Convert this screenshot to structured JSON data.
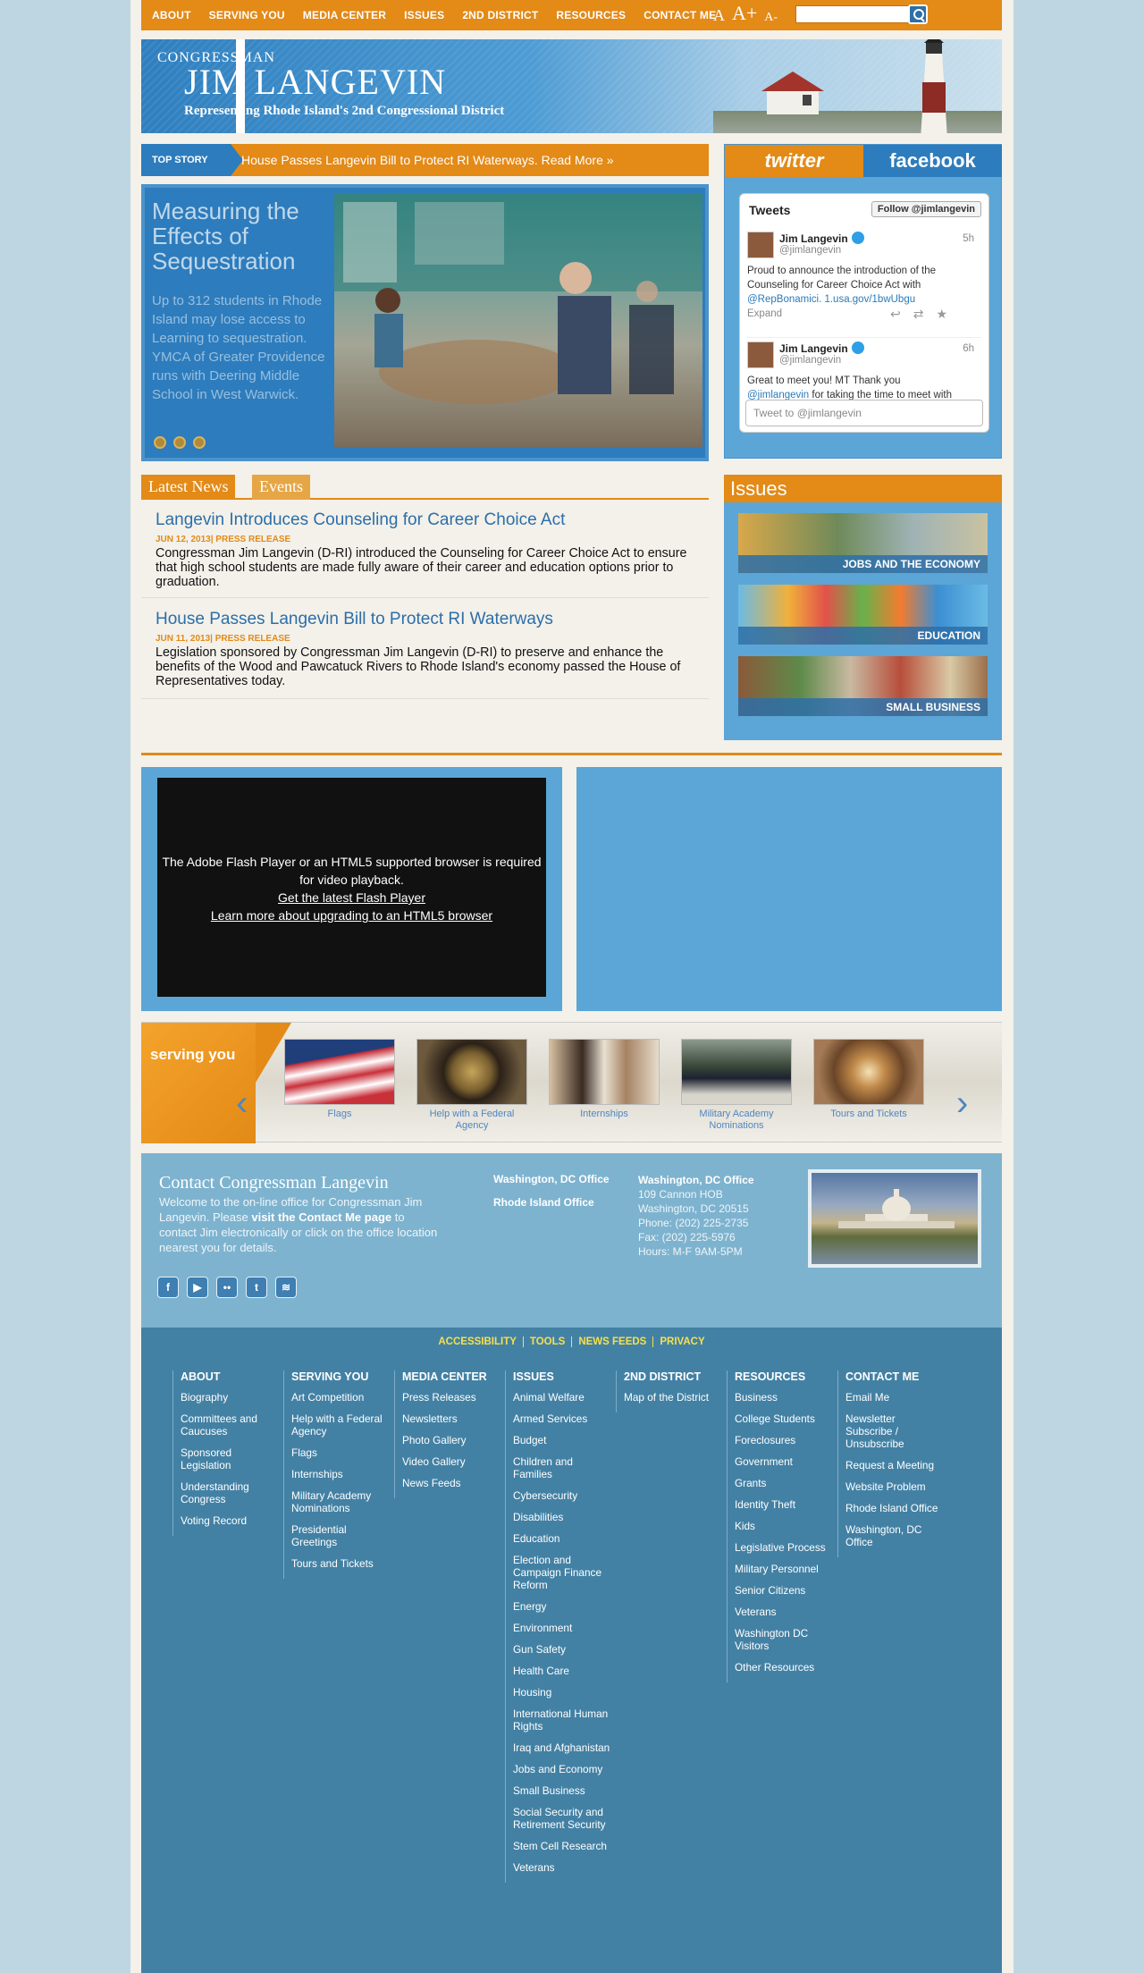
{
  "nav": {
    "items": [
      "ABOUT",
      "SERVING YOU",
      "MEDIA CENTER",
      "ISSUES",
      "2ND DISTRICT",
      "RESOURCES",
      "CONTACT ME"
    ],
    "font_sizes": [
      "A",
      "A+",
      "A-"
    ],
    "search_placeholder": ""
  },
  "header": {
    "congressman": "CONGRESSMAN",
    "name": "JIM LANGEVIN",
    "tagline": "Representing Rhode Island's 2nd Congressional District"
  },
  "top_story": {
    "label": "TOP STORY",
    "text": "House Passes Langevin Bill to Protect RI Waterways. Read More »"
  },
  "slideshow": {
    "title": "Measuring the Effects of Sequestration",
    "text": "Up to 312 students in Rhode Island may lose access to Learning to sequestration. YMCA of Greater Providence runs with Deering Middle School in West Warwick."
  },
  "twitter": {
    "tab_twitter": "twitter",
    "tab_facebook": "facebook",
    "heading": "Tweets",
    "follow": "Follow @jimlangevin",
    "tweets": [
      {
        "name": "Jim Langevin",
        "handle": "@jimlangevin",
        "time": "5h",
        "text": "Proud to announce the introduction of the Counseling for Career Choice Act with ",
        "link": "@RepBonamici. 1.usa.gov/1bwUbgu",
        "expand": "Expand"
      },
      {
        "name": "Jim Langevin",
        "handle": "@jimlangevin",
        "time": "6h",
        "text": "Great to meet you! MT Thank you ",
        "link": "@jimlangevin",
        "text2": " for taking the time to meet with"
      }
    ],
    "input_placeholder": "Tweet to @jimlangevin"
  },
  "news": {
    "tab_latest": "Latest News",
    "tab_events": "Events",
    "items": [
      {
        "title": "Langevin Introduces Counseling for Career Choice Act",
        "date": "JUN 12, 2013",
        "type": "PRESS RELEASE",
        "text": "Congressman Jim Langevin (D-RI) introduced the Counseling for Career Choice Act to ensure that high school students are made fully aware of their career and education options prior to graduation."
      },
      {
        "title": "House Passes Langevin Bill to Protect RI Waterways",
        "date": "JUN 11, 2013",
        "type": "PRESS RELEASE",
        "text": "Legislation sponsored by Congressman Jim Langevin (D-RI) to preserve and enhance the benefits of the Wood and Pawcatuck Rivers to Rhode Island's economy passed the House of Representatives today."
      }
    ]
  },
  "issues": {
    "heading": "Issues",
    "cards": [
      "JOBS AND THE ECONOMY",
      "EDUCATION",
      "SMALL BUSINESS"
    ]
  },
  "video": {
    "line1": "The Adobe Flash Player or an HTML5 supported browser is required for video playback.",
    "link1": "Get the latest Flash Player",
    "link2": "Learn more about upgrading to an HTML5 browser"
  },
  "serving": {
    "title": "serving you",
    "items": [
      "Flags",
      "Help with a Federal Agency",
      "Internships",
      "Military Academy Nominations",
      "Tours and Tickets"
    ]
  },
  "contact": {
    "heading": "Contact Congressman Langevin",
    "text_pre": "Welcome to the on-line office for Congressman Jim Langevin. Please ",
    "text_bold": "visit the Contact Me page",
    "text_post": " to contact Jim electronically or click on the office location nearest you for details.",
    "offices": [
      "Washington, DC Office",
      "Rhode Island Office"
    ],
    "address_title": "Washington, DC Office",
    "address_lines": [
      "109 Cannon HOB",
      "Washington, DC 20515",
      "Phone: (202) 225-2735",
      "Fax: (202) 225-5976",
      "Hours: M-F 9AM-5PM"
    ],
    "social": [
      "facebook-icon",
      "youtube-icon",
      "flickr-icon",
      "twitter-icon",
      "rss-icon"
    ]
  },
  "footer": {
    "links": [
      "ACCESSIBILITY",
      "TOOLS",
      "NEWS FEEDS",
      "PRIVACY"
    ],
    "columns": [
      {
        "heading": "ABOUT",
        "items": [
          "Biography",
          "Committees and Caucuses",
          "Sponsored Legislation",
          "Understanding Congress",
          "Voting Record"
        ]
      },
      {
        "heading": "SERVING YOU",
        "items": [
          "Art Competition",
          "Help with a Federal Agency",
          "Flags",
          "Internships",
          "Military Academy Nominations",
          "Presidential Greetings",
          "Tours and Tickets"
        ]
      },
      {
        "heading": "MEDIA CENTER",
        "items": [
          "Press Releases",
          "Newsletters",
          "Photo Gallery",
          "Video Gallery",
          "News Feeds"
        ]
      },
      {
        "heading": "ISSUES",
        "items": [
          "Animal Welfare",
          "Armed Services",
          "Budget",
          "Children and Families",
          "Cybersecurity",
          "Disabilities",
          "Education",
          "Election and Campaign Finance Reform",
          "Energy",
          "Environment",
          "Gun Safety",
          "Health Care",
          "Housing",
          "International Human Rights",
          "Iraq and Afghanistan",
          "Jobs and Economy",
          "Small Business",
          "Social Security and Retirement Security",
          "Stem Cell Research",
          "Veterans"
        ]
      },
      {
        "heading": "2ND DISTRICT",
        "items": [
          "Map of the District"
        ]
      },
      {
        "heading": "RESOURCES",
        "items": [
          "Business",
          "College Students",
          "Foreclosures",
          "Government",
          "Grants",
          "Identity Theft",
          "Kids",
          "Legislative Process",
          "Military Personnel",
          "Senior Citizens",
          "Veterans",
          "Washington DC Visitors",
          "Other Resources"
        ]
      },
      {
        "heading": "CONTACT ME",
        "items": [
          "Email Me",
          "Newsletter Subscribe / Unsubscribe",
          "Request a Meeting",
          "Website Problem",
          "Rhode Island Office",
          "Washington, DC Office"
        ]
      }
    ]
  }
}
